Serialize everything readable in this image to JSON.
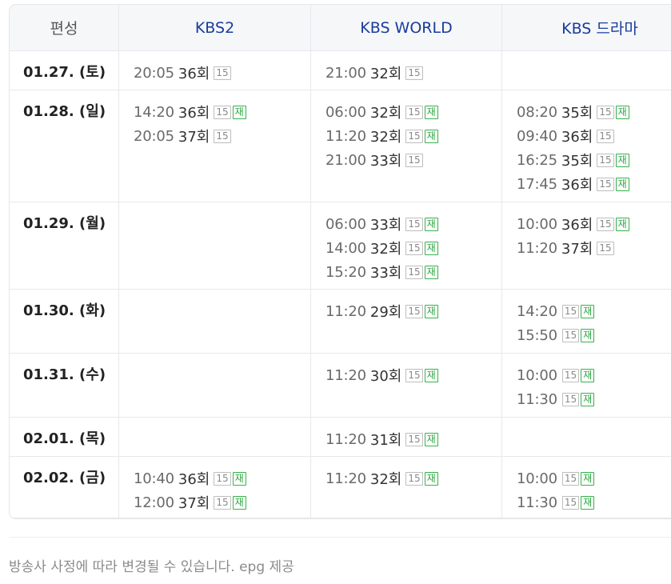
{
  "headers": [
    "편성",
    "KBS2",
    "KBS WORLD",
    "KBS 드라마"
  ],
  "rows": [
    {
      "date": "01.27. (토)",
      "channels": [
        [
          {
            "time": "20:05",
            "ep": "36회",
            "rating": "15",
            "rerun": ""
          }
        ],
        [
          {
            "time": "21:00",
            "ep": "32회",
            "rating": "15",
            "rerun": ""
          }
        ],
        []
      ]
    },
    {
      "date": "01.28. (일)",
      "channels": [
        [
          {
            "time": "14:20",
            "ep": "36회",
            "rating": "15",
            "rerun": "재"
          },
          {
            "time": "20:05",
            "ep": "37회",
            "rating": "15",
            "rerun": ""
          }
        ],
        [
          {
            "time": "06:00",
            "ep": "32회",
            "rating": "15",
            "rerun": "재"
          },
          {
            "time": "11:20",
            "ep": "32회",
            "rating": "15",
            "rerun": "재"
          },
          {
            "time": "21:00",
            "ep": "33회",
            "rating": "15",
            "rerun": ""
          }
        ],
        [
          {
            "time": "08:20",
            "ep": "35회",
            "rating": "15",
            "rerun": "재"
          },
          {
            "time": "09:40",
            "ep": "36회",
            "rating": "15",
            "rerun": ""
          },
          {
            "time": "16:25",
            "ep": "35회",
            "rating": "15",
            "rerun": "재"
          },
          {
            "time": "17:45",
            "ep": "36회",
            "rating": "15",
            "rerun": "재"
          }
        ]
      ]
    },
    {
      "date": "01.29. (월)",
      "channels": [
        [],
        [
          {
            "time": "06:00",
            "ep": "33회",
            "rating": "15",
            "rerun": "재"
          },
          {
            "time": "14:00",
            "ep": "32회",
            "rating": "15",
            "rerun": "재"
          },
          {
            "time": "15:20",
            "ep": "33회",
            "rating": "15",
            "rerun": "재"
          }
        ],
        [
          {
            "time": "10:00",
            "ep": "36회",
            "rating": "15",
            "rerun": "재"
          },
          {
            "time": "11:20",
            "ep": "37회",
            "rating": "15",
            "rerun": ""
          }
        ]
      ]
    },
    {
      "date": "01.30. (화)",
      "channels": [
        [],
        [
          {
            "time": "11:20",
            "ep": "29회",
            "rating": "15",
            "rerun": "재"
          }
        ],
        [
          {
            "time": "14:20",
            "ep": "",
            "rating": "15",
            "rerun": "재"
          },
          {
            "time": "15:50",
            "ep": "",
            "rating": "15",
            "rerun": "재"
          }
        ]
      ]
    },
    {
      "date": "01.31. (수)",
      "channels": [
        [],
        [
          {
            "time": "11:20",
            "ep": "30회",
            "rating": "15",
            "rerun": "재"
          }
        ],
        [
          {
            "time": "10:00",
            "ep": "",
            "rating": "15",
            "rerun": "재"
          },
          {
            "time": "11:30",
            "ep": "",
            "rating": "15",
            "rerun": "재"
          }
        ]
      ]
    },
    {
      "date": "02.01. (목)",
      "channels": [
        [],
        [
          {
            "time": "11:20",
            "ep": "31회",
            "rating": "15",
            "rerun": "재"
          }
        ],
        []
      ]
    },
    {
      "date": "02.02. (금)",
      "channels": [
        [
          {
            "time": "10:40",
            "ep": "36회",
            "rating": "15",
            "rerun": "재"
          },
          {
            "time": "12:00",
            "ep": "37회",
            "rating": "15",
            "rerun": "재"
          }
        ],
        [
          {
            "time": "11:20",
            "ep": "32회",
            "rating": "15",
            "rerun": "재"
          }
        ],
        [
          {
            "time": "10:00",
            "ep": "",
            "rating": "15",
            "rerun": "재"
          },
          {
            "time": "11:30",
            "ep": "",
            "rating": "15",
            "rerun": "재"
          }
        ]
      ]
    }
  ],
  "footnote": "방송사 사정에 따라 변경될 수 있습니다. epg 제공",
  "colors": {
    "header_bg": "#f5f7f9",
    "channel_header_text": "#1a3c9c",
    "rerun_badge": "#35b24a",
    "rating_badge": "#bdbdbd"
  }
}
